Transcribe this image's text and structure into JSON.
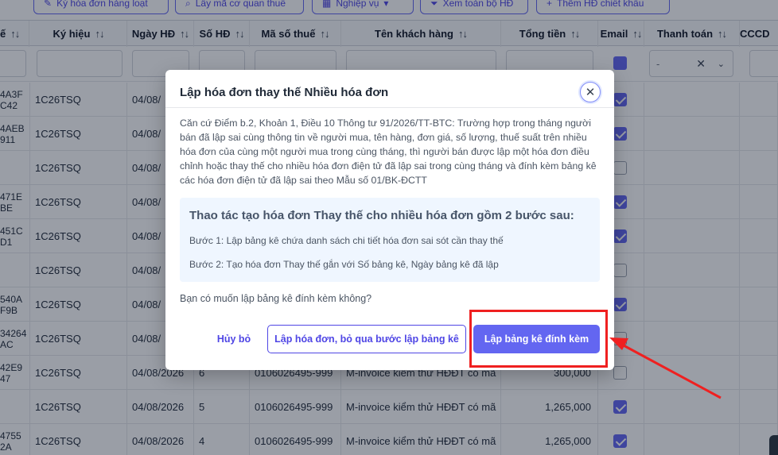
{
  "toolbar": {
    "buttons": [
      {
        "label": "Ký hóa đơn hàng loạt",
        "icon": "pen-icon"
      },
      {
        "label": "Lấy mã cơ quan thuế",
        "icon": "search-icon"
      },
      {
        "label": "Nghiệp vụ",
        "icon": "grid-icon"
      },
      {
        "label": "Xem toàn bộ HĐ",
        "icon": "filter-icon"
      },
      {
        "label": "Thêm HĐ chiết khấu",
        "icon": "plus-icon"
      }
    ]
  },
  "table": {
    "headers": [
      "ế",
      "Ký hiệu",
      "Ngày HĐ",
      "Số HĐ",
      "Mã số thuế",
      "Tên khách hàng",
      "Tổng tiền",
      "Email",
      "Thanh toán",
      "CCCD"
    ],
    "sort_icon": "↑↓",
    "filter_select_value": "-",
    "rows": [
      {
        "code": "4A3F\nC42",
        "symbol": "1C26TSQ",
        "date": "04/08/",
        "num": "",
        "tax": "",
        "customer": "",
        "total": "",
        "email": true
      },
      {
        "code": "4AEB\n911",
        "symbol": "1C26TSQ",
        "date": "04/08/",
        "num": "",
        "tax": "",
        "customer": "",
        "total": "",
        "email": true
      },
      {
        "code": "",
        "symbol": "1C26TSQ",
        "date": "04/08/",
        "num": "",
        "tax": "",
        "customer": "",
        "total": "",
        "email": false
      },
      {
        "code": "471E\nBE",
        "symbol": "1C26TSQ",
        "date": "04/08/",
        "num": "",
        "tax": "",
        "customer": "",
        "total": "",
        "email": true
      },
      {
        "code": "451C\nD1",
        "symbol": "1C26TSQ",
        "date": "04/08/",
        "num": "",
        "tax": "",
        "customer": "",
        "total": "",
        "email": true
      },
      {
        "code": "",
        "symbol": "1C26TSQ",
        "date": "04/08/",
        "num": "",
        "tax": "",
        "customer": "",
        "total": "",
        "email": false
      },
      {
        "code": "540A\nF9B",
        "symbol": "1C26TSQ",
        "date": "04/08/",
        "num": "",
        "tax": "",
        "customer": "",
        "total": "",
        "email": true
      },
      {
        "code": "34264\nAC",
        "symbol": "1C26TSQ",
        "date": "04/08/",
        "num": "",
        "tax": "",
        "customer": "",
        "total": "",
        "email": false
      },
      {
        "code": "42E9\n47",
        "symbol": "1C26TSQ",
        "date": "04/08/2026",
        "num": "6",
        "tax": "0106026495-999",
        "customer": "M-invoice kiểm thử HĐĐT có mã",
        "total": "300,000",
        "email": false
      },
      {
        "code": "",
        "symbol": "1C26TSQ",
        "date": "04/08/2026",
        "num": "5",
        "tax": "0106026495-999",
        "customer": "M-invoice kiểm thử HĐĐT có mã",
        "total": "1,265,000",
        "email": true
      },
      {
        "code": "4755\n2A",
        "symbol": "1C26TSQ",
        "date": "04/08/2026",
        "num": "4",
        "tax": "0106026495-999",
        "customer": "M-invoice kiểm thử HĐĐT có mã",
        "total": "1,265,000",
        "email": true
      }
    ]
  },
  "modal": {
    "title": "Lập hóa đơn thay thế Nhiều hóa đơn",
    "body": "Căn cứ Điểm b.2, Khoản 1, Điều 10 Thông tư 91/2026/TT-BTC: Trường hợp trong tháng người bán đã lập sai cùng thông tin về người mua, tên hàng, đơn giá, số lượng, thuế suất trên nhiều hóa đơn của cùng một người mua trong cùng tháng, thì người bán được lập một hóa đơn điều chỉnh hoặc thay thế cho nhiều hóa đơn điện tử đã lập sai trong cùng tháng và đính kèm bảng kê các hóa đơn điện tử đã lập sai theo Mẫu số 01/BK-ĐCTT",
    "info_title": "Thao tác tạo hóa đơn Thay thế cho nhiều hóa đơn gồm 2 bước sau:",
    "step1": "Bước 1: Lập bảng kê chứa danh sách chi tiết hóa đơn sai sót cần thay thế",
    "step2": "Bước 2: Tạo hóa đơn Thay thế gắn với Số bảng kê, Ngày bảng kê đã lập",
    "question": "Bạn có muốn lập bảng kê đính kèm không?",
    "cancel_label": "Hủy bỏ",
    "skip_label": "Lập hóa đơn, bỏ qua bước lập bảng kê",
    "primary_label": "Lập bảng kê đính kèm",
    "close_icon": "close-icon"
  },
  "colors": {
    "accent": "#6366f1",
    "highlight": "#ef2020"
  }
}
